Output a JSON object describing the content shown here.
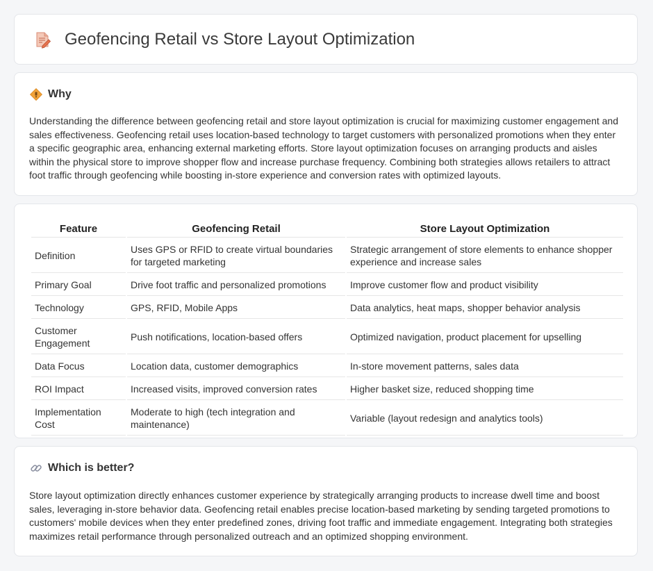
{
  "header": {
    "title": "Geofencing Retail vs Store Layout Optimization",
    "icon": "document-pencil-icon"
  },
  "why": {
    "title": "Why",
    "icon": "diamond-sign-icon",
    "text": "Understanding the difference between geofencing retail and store layout optimization is crucial for maximizing customer engagement and sales effectiveness. Geofencing retail uses location-based technology to target customers with personalized promotions when they enter a specific geographic area, enhancing external marketing efforts. Store layout optimization focuses on arranging products and aisles within the physical store to improve shopper flow and increase purchase frequency. Combining both strategies allows retailers to attract foot traffic through geofencing while boosting in-store experience and conversion rates with optimized layouts."
  },
  "table": {
    "headers": [
      "Feature",
      "Geofencing Retail",
      "Store Layout Optimization"
    ],
    "rows": [
      [
        "Definition",
        "Uses GPS or RFID to create virtual boundaries for targeted marketing",
        "Strategic arrangement of store elements to enhance shopper experience and increase sales"
      ],
      [
        "Primary Goal",
        "Drive foot traffic and personalized promotions",
        "Improve customer flow and product visibility"
      ],
      [
        "Technology",
        "GPS, RFID, Mobile Apps",
        "Data analytics, heat maps, shopper behavior analysis"
      ],
      [
        "Customer Engagement",
        "Push notifications, location-based offers",
        "Optimized navigation, product placement for upselling"
      ],
      [
        "Data Focus",
        "Location data, customer demographics",
        "In-store movement patterns, sales data"
      ],
      [
        "ROI Impact",
        "Increased visits, improved conversion rates",
        "Higher basket size, reduced shopping time"
      ],
      [
        "Implementation Cost",
        "Moderate to high (tech integration and maintenance)",
        "Variable (layout redesign and analytics tools)"
      ]
    ]
  },
  "better": {
    "title": "Which is better?",
    "icon": "link-icon",
    "text": "Store layout optimization directly enhances customer experience by strategically arranging products to increase dwell time and boost sales, leveraging in-store behavior data. Geofencing retail enables precise location-based marketing by sending targeted promotions to customers' mobile devices when they enter predefined zones, driving foot traffic and immediate engagement. Integrating both strategies maximizes retail performance through personalized outreach and an optimized shopping environment."
  }
}
